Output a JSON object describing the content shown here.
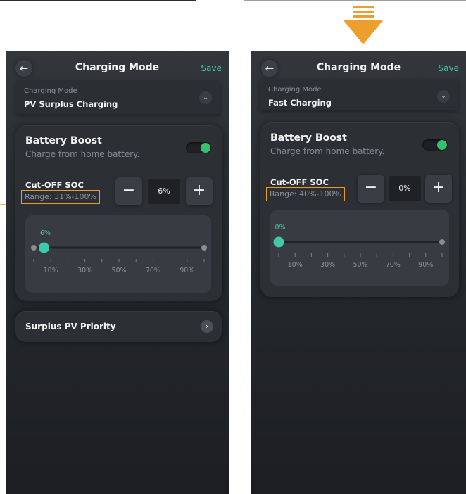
{
  "colors": {
    "accent": "#3ec9a8",
    "toggle_on": "#35c26e",
    "highlight": "#e99a2c",
    "arrow": "#ec9f2e",
    "panel_bg": "#2c2f34"
  },
  "icons": {
    "back": "←",
    "chevron_down": "⌄",
    "chevron_right": "›",
    "minus": "−",
    "plus": "+"
  },
  "screens": [
    {
      "header": {
        "title": "Charging Mode",
        "save_label": "Save"
      },
      "mode": {
        "label": "Charging Mode",
        "value": "PV Surplus Charging"
      },
      "boost": {
        "title": "Battery Boost",
        "subtitle": "Charge from home battery.",
        "enabled": true
      },
      "soc": {
        "label": "Cut-OFF SOC",
        "range": "Range: 31%-100%",
        "value": "6%"
      },
      "slider": {
        "value": 6,
        "value_label": "6%",
        "ticks": [
          "10%",
          "30%",
          "50%",
          "70%",
          "90%"
        ]
      },
      "surplus": {
        "label": "Surplus PV Priority"
      }
    },
    {
      "header": {
        "title": "Charging Mode",
        "save_label": "Save"
      },
      "mode": {
        "label": "Charging Mode",
        "value": "Fast Charging"
      },
      "boost": {
        "title": "Battery Boost",
        "subtitle": "Charge from home battery.",
        "enabled": true
      },
      "soc": {
        "label": "Cut-OFF SOC",
        "range": "Range: 40%-100%",
        "value": "0%"
      },
      "slider": {
        "value": 0,
        "value_label": "0%",
        "ticks": [
          "10%",
          "30%",
          "50%",
          "70%",
          "90%"
        ]
      }
    }
  ]
}
